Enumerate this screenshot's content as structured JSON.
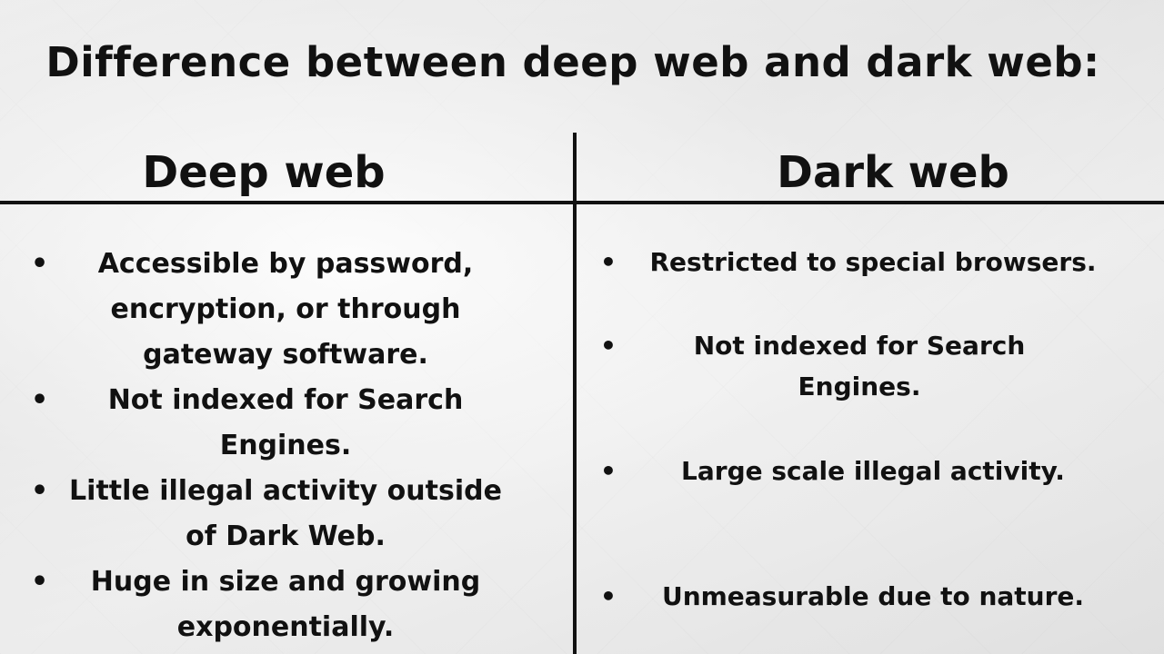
{
  "title": "Difference between deep web and dark web:",
  "bullet_symbol": "•",
  "deep_web": {
    "heading": "Deep web",
    "items": [
      "Accessible by password, encryption, or through gateway software.",
      "Not indexed for Search Engines.",
      "Little illegal activity outside of Dark Web.",
      "Huge in size and growing exponentially."
    ]
  },
  "dark_web": {
    "heading": "Dark web",
    "items": [
      "Restricted to special browsers.",
      "Not indexed for Search Engines.",
      "Large scale illegal activity.",
      "Unmeasurable due to nature."
    ]
  },
  "colors": {
    "text": "#111111",
    "lines": "#111111"
  }
}
